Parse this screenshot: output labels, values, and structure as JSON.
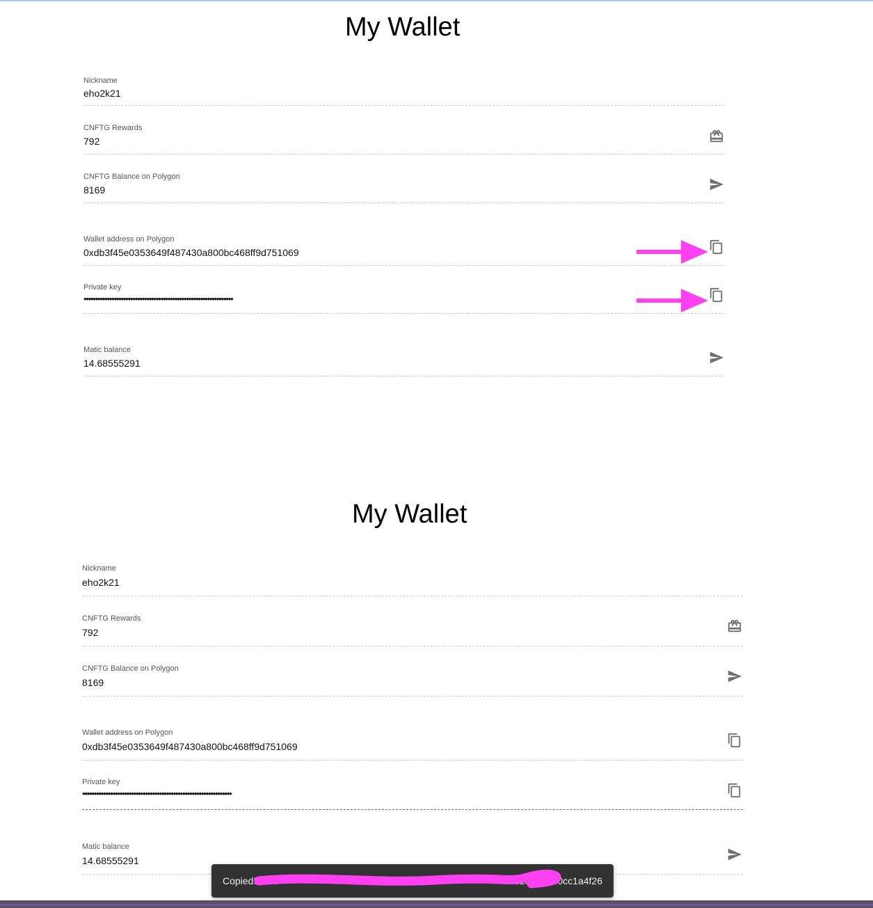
{
  "wallet_top": {
    "title": "My Wallet",
    "fields": {
      "nickname": {
        "label": "Nickname",
        "value": "eho2k21"
      },
      "rewards": {
        "label": "CNFTG Rewards",
        "value": "792"
      },
      "balance": {
        "label": "CNFTG Balance on Polygon",
        "value": "8169"
      },
      "address": {
        "label": "Wallet address on Polygon",
        "value": "0xdb3f45e0353649f487430a800bc468ff9d751069"
      },
      "private_key": {
        "label": "Private key",
        "value": "••••••••••••••••••••••••••••••••••••••••••••••••••••••••••••••••"
      },
      "matic": {
        "label": "Matic balance",
        "value": "14.68555291"
      }
    }
  },
  "wallet_bottom": {
    "title": "My Wallet",
    "fields": {
      "nickname": {
        "label": "Nickname",
        "value": "eho2k21"
      },
      "rewards": {
        "label": "CNFTG Rewards",
        "value": "792"
      },
      "balance": {
        "label": "CNFTG Balance on Polygon",
        "value": "8169"
      },
      "address": {
        "label": "Wallet address on Polygon",
        "value": "0xdb3f45e0353649f487430a800bc468ff9d751069"
      },
      "private_key": {
        "label": "Private key",
        "value": "••••••••••••••••••••••••••••••••••••••••••••••••••••••••••••••••"
      },
      "matic": {
        "label": "Matic balance",
        "value": "14.68555291"
      }
    }
  },
  "toast": {
    "message": "Copied! 0x…",
    "visible_tail": "…3264154e0cc1a4f26"
  },
  "icons": {
    "rewards": "redeem-icon",
    "send": "send-icon",
    "copy": "copy-icon"
  },
  "colors": {
    "annotation": "#ff40f0",
    "icon": "#6f6f6f",
    "toast_bg": "#323232"
  }
}
